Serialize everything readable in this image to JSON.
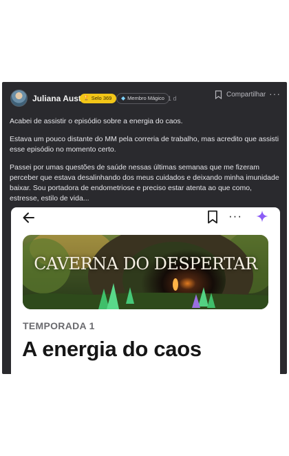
{
  "author": {
    "name": "Juliana Austim",
    "badge_selo": "Selo 369",
    "badge_membro": "Membro Mágico",
    "time": "1 d"
  },
  "actions": {
    "share_label": "Compartilhar",
    "more_label": "···"
  },
  "post": {
    "paragraphs": [
      "Acabei de assistir o episódio sobre a energia do caos.",
      "Estava um pouco distante do MM pela correria de trabalho, mas acredito que assisti esse episódio no momento certo.",
      "Passei por umas questões de saúde nessas últimas semanas que me fizeram perceber que estava desalinhando dos meus cuidados e deixando minha imunidade baixar. Sou portadora de endometriose e preciso estar atenta ao que como, estresse, estilo de vida..."
    ]
  },
  "embed": {
    "more_label": "···",
    "cover_title": "CAVERNA DO DESPERTAR",
    "season": "TEMPORADA 1",
    "episode_title": "A energia do caos"
  },
  "colors": {
    "card_bg": "#2a2a2e",
    "badge_gold": "#f2c618",
    "sparkle_purple": "#8b5cf6"
  },
  "icons": {
    "avatar": "avatar",
    "trophy": "trophy-icon",
    "diamond": "diamond-icon",
    "bookmark": "bookmark-icon",
    "more": "more-horizontal-icon",
    "back": "arrow-left-icon",
    "sparkle": "sparkle-icon"
  }
}
